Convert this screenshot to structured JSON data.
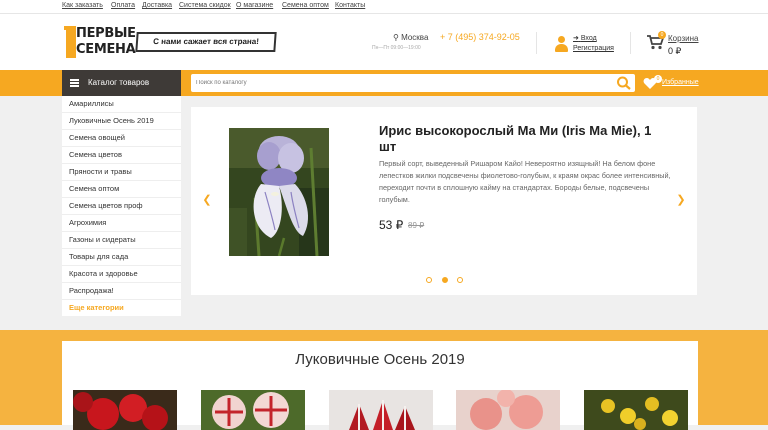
{
  "topbar": {
    "links": [
      "Как заказать",
      "Оплата",
      "Доставка",
      "Система скидок",
      "О магазине",
      "Семена оптом",
      "Контакты"
    ]
  },
  "header": {
    "logo_line1": "ПЕРВЫЕ",
    "logo_line2": "СЕМЕНА",
    "slogan": "С нами сажает вся страна!",
    "city": "Москва",
    "hours": "Пн—Пт 09:00—19:00",
    "phone": "+ 7 (495) 374-92-05",
    "login": "Вход",
    "register": "Регистрация",
    "cart_label": "Корзина",
    "cart_count": "0",
    "cart_sum": "0 ₽"
  },
  "nav": {
    "catalog_label": "Каталог товаров",
    "search_placeholder": "Поиск по каталогу",
    "favorites_label": "Избранные",
    "favorites_count": "0"
  },
  "sidebar": {
    "items": [
      "Амариллисы",
      "Луковичные Осень 2019",
      "Семена овощей",
      "Семена цветов",
      "Пряности и травы",
      "Семена оптом",
      "Семена цветов проф",
      "Агрохимия",
      "Газоны и сидераты",
      "Товары для сада",
      "Красота и здоровье",
      "Распродажа!"
    ],
    "more_label": "Еще категории"
  },
  "slider": {
    "title": "Ирис высокорослый Ма Ми (Iris Ma Mie), 1 шт",
    "description": "Первый сорт, выведенный Ришаром Кайо! Невероятно изящный! На белом фоне лепестков жилки подсвечены фиолетово-голубым, к краям окрас более интенсивный, переходит почти в сплошную кайму на стандартах. Бороды белые, подсвечены голубым.",
    "price": "53 ₽",
    "old_price": "89 ₽",
    "slide_count": 3,
    "active_slide": 2
  },
  "section": {
    "title": "Луковичные Осень 2019"
  },
  "colors": {
    "accent": "#f6a821",
    "dark": "#3e3a37"
  }
}
